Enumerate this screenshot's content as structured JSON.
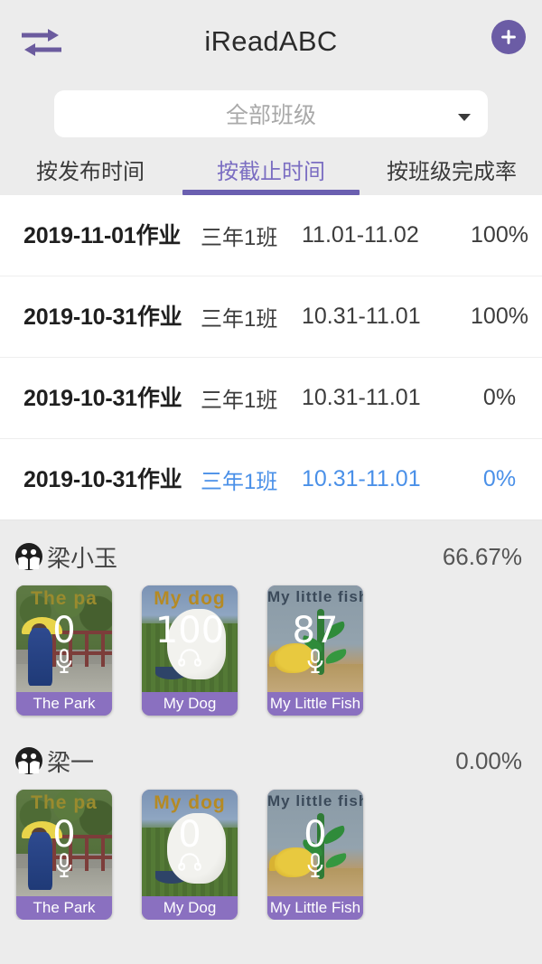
{
  "header": {
    "title": "iReadABC",
    "swap_icon": "swap-horizontal-icon",
    "add_icon": "plus-circle-icon",
    "accent_purple": "#6b5ca5"
  },
  "class_selector": {
    "value": "全部班级",
    "caret_icon": "chevron-down-icon"
  },
  "tabs": [
    {
      "label": "按发布时间",
      "active": false
    },
    {
      "label": "按截止时间",
      "active": true
    },
    {
      "label": "按班级完成率",
      "active": false
    }
  ],
  "tab_active_color": "#7b6ec2",
  "assignments": [
    {
      "name": "2019-11-01作业",
      "class": "三年1班",
      "dates": "11.01-11.02",
      "rate": "100%",
      "selected": false
    },
    {
      "name": "2019-10-31作业",
      "class": "三年1班",
      "dates": "10.31-11.01",
      "rate": "100%",
      "selected": false
    },
    {
      "name": "2019-10-31作业",
      "class": "三年1班",
      "dates": "10.31-11.01",
      "rate": "0%",
      "selected": false
    },
    {
      "name": "2019-10-31作业",
      "class": "三年1班",
      "dates": "10.31-11.01",
      "rate": "0%",
      "selected": true
    }
  ],
  "selected_row_color": "#4a90e8",
  "students": [
    {
      "avatar_icon": "student-group-icon",
      "name": "梁小玉",
      "rate": "66.67%",
      "cards": [
        {
          "label": "The Park",
          "thumb_title": "The  pa",
          "score": "0",
          "media_icon": "microphone-icon"
        },
        {
          "label": "My Dog",
          "thumb_title": "My  dog",
          "score": "100",
          "media_icon": "headphones-icon"
        },
        {
          "label": "My Little Fish",
          "thumb_title": "My  little  fish",
          "score": "87",
          "media_icon": "microphone-icon"
        }
      ]
    },
    {
      "avatar_icon": "student-group-icon",
      "name": "梁一",
      "rate": "0.00%",
      "cards": [
        {
          "label": "The Park",
          "thumb_title": "The  pa",
          "score": "0",
          "media_icon": "microphone-icon"
        },
        {
          "label": "My Dog",
          "thumb_title": "My  dog",
          "score": "0",
          "media_icon": "headphones-icon"
        },
        {
          "label": "My Little Fish",
          "thumb_title": "My  little  fish",
          "score": "0",
          "media_icon": "microphone-icon"
        }
      ]
    }
  ],
  "card_label_color": "#8a70c0"
}
